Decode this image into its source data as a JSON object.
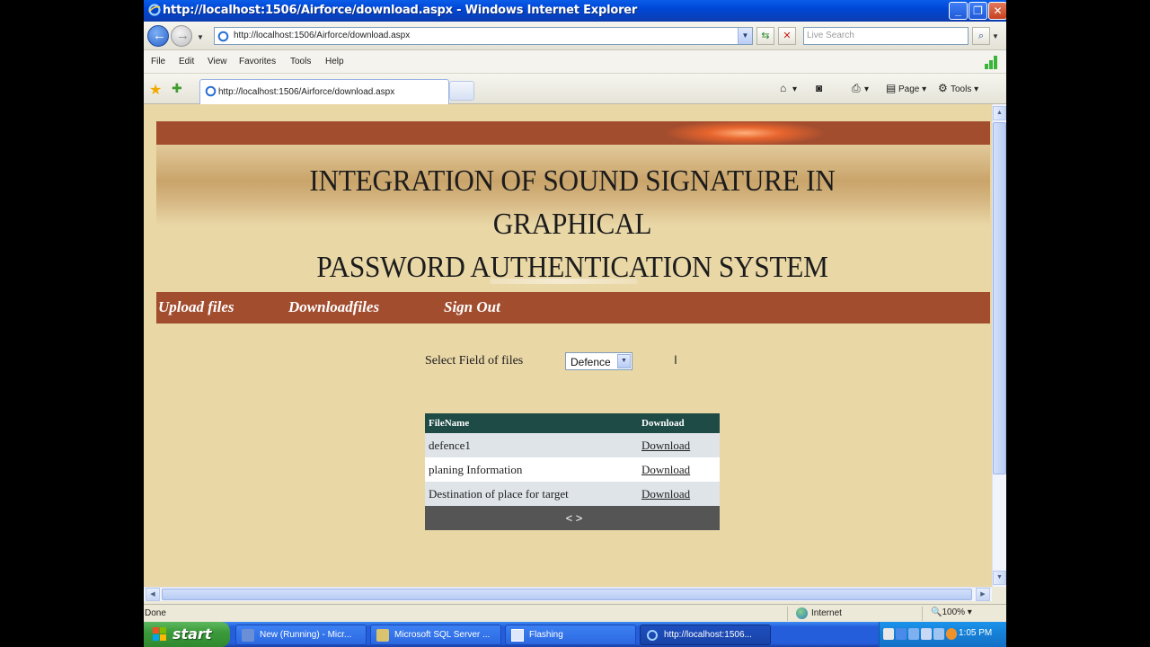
{
  "window": {
    "title": "http://localhost:1506/Airforce/download.aspx - Windows Internet Explorer",
    "minimize": "_",
    "maximize": "❐",
    "close": "✕"
  },
  "address_bar": {
    "url": "http://localhost:1506/Airforce/download.aspx",
    "search_placeholder": "Live Search"
  },
  "menu": [
    "File",
    "Edit",
    "View",
    "Favorites",
    "Tools",
    "Help"
  ],
  "tab": {
    "label": "http://localhost:1506/Airforce/download.aspx"
  },
  "command_bar": {
    "page": "Page",
    "tools": "Tools"
  },
  "page": {
    "banner_title_line1": "INTEGRATION OF SOUND SIGNATURE IN GRAPHICAL",
    "banner_title_line2": "PASSWORD AUTHENTICATION SYSTEM",
    "nav": [
      "Upload files",
      "Downloadfiles",
      "Sign Out"
    ],
    "select_label": "Select Field of files",
    "select_value": "Defence",
    "table": {
      "headers": [
        "FileName",
        "Download"
      ],
      "rows": [
        {
          "name": "defence1",
          "link": "Download"
        },
        {
          "name": "planing Information",
          "link": "Download"
        },
        {
          "name": "Destination of place for target",
          "link": "Download"
        }
      ],
      "pager": "< >"
    }
  },
  "status": {
    "left": "Done",
    "zone": "Internet",
    "zoom": "100%"
  },
  "taskbar": {
    "start": "start",
    "tasks": [
      "New (Running) - Micr...",
      "Microsoft SQL Server ...",
      "Flashing",
      "http://localhost:1506..."
    ],
    "clock": "1:05 PM"
  },
  "colors": {
    "page_background": "#e9d7a6",
    "banner_accent": "#a34d2f",
    "grid_header": "#1e4b46",
    "pager": "#555555"
  }
}
